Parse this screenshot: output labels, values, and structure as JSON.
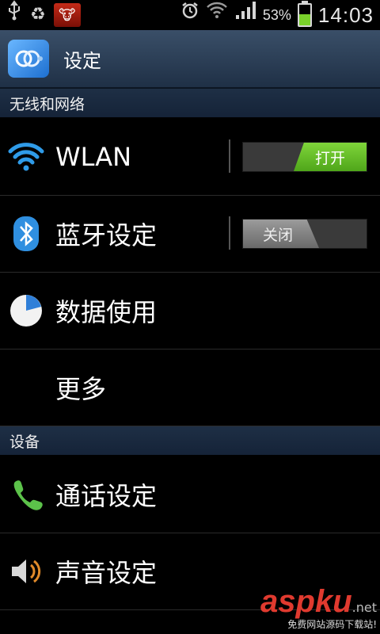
{
  "status_bar": {
    "left_icons": [
      "usb-icon",
      "recycle-icon",
      "notification-app-icon"
    ],
    "right_icons": [
      "alarm-icon",
      "wifi-data-icon",
      "signal-icon"
    ],
    "battery_percent": "53%",
    "battery_level": 0.53,
    "time": "14:03"
  },
  "title_bar": {
    "title": "设定",
    "icon": "settings-gear-icon"
  },
  "sections": [
    {
      "header": "无线和网络",
      "items": [
        {
          "label": "WLAN",
          "icon": "wifi-icon",
          "toggle": {
            "state": "on",
            "label": "打开"
          }
        },
        {
          "label": "蓝牙设定",
          "icon": "bluetooth-icon",
          "toggle": {
            "state": "off",
            "label": "关闭"
          }
        },
        {
          "label": "数据使用",
          "icon": "data-usage-pie-icon"
        },
        {
          "label": "更多",
          "icon": ""
        }
      ]
    },
    {
      "header": "设备",
      "items": [
        {
          "label": "通话设定",
          "icon": "phone-icon"
        },
        {
          "label": "声音设定",
          "icon": "speaker-icon"
        }
      ]
    }
  ],
  "watermark": {
    "main": "aspku",
    "tld": ".net",
    "subtitle": "免费网站源码下载站!"
  },
  "colors": {
    "toggle_on": "#6cc22a",
    "title_bar": "#2d4058",
    "section_header": "#1a2a40",
    "wifi_blue": "#2f9be8"
  }
}
